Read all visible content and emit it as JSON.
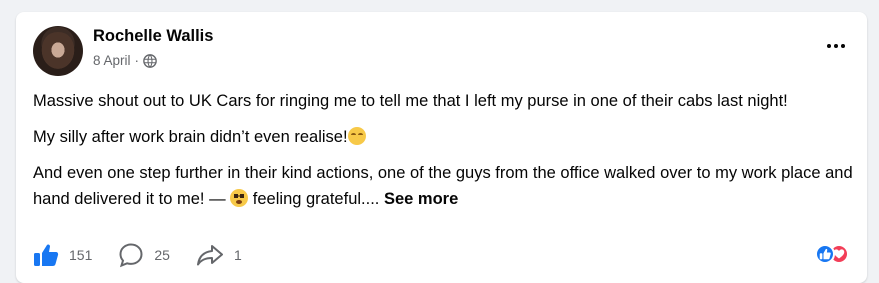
{
  "post": {
    "author": "Rochelle Wallis",
    "date": "8 April",
    "separator": "·",
    "paragraphs": {
      "p1": "Massive shout out to UK Cars for ringing me to tell me that I left my purse in one of their cabs last night!",
      "p2": "My silly after work brain didn’t even realise!",
      "p3_text": "And even one step further in their kind actions, one of the guys from the office walked over to my work place and hand delivered it to me! —",
      "p3_feeling": "feeling grateful....",
      "see_more": "See more"
    }
  },
  "footer": {
    "like_count": "151",
    "comment_count": "25",
    "share_count": "1"
  },
  "icons": {
    "privacy": "globe-icon",
    "more": "more-options-icon",
    "like": "thumbs-up-icon",
    "comment": "comment-bubble-icon",
    "share": "share-arrow-icon",
    "reactions": [
      "like-reaction-icon",
      "love-reaction-icon"
    ]
  },
  "colors": {
    "accent": "#1877f2",
    "love": "#f33e58",
    "muted": "#65676b",
    "text": "#050505"
  }
}
